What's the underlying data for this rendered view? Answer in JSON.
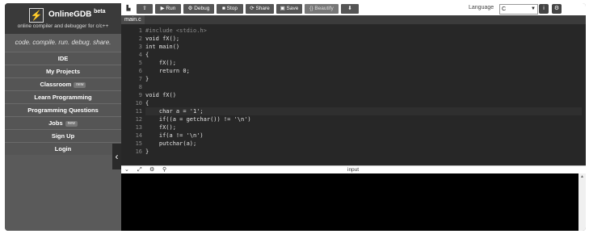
{
  "sidebar": {
    "logo_glyph": "⚡",
    "title": "OnlineGDB",
    "title_sup": "beta",
    "subtitle": "online compiler and debugger for c/c++",
    "tagline": "code. compile. run. debug. share.",
    "items": [
      {
        "label": "IDE",
        "badge": ""
      },
      {
        "label": "My Projects",
        "badge": ""
      },
      {
        "label": "Classroom",
        "badge": "new"
      },
      {
        "label": "Learn Programming",
        "badge": ""
      },
      {
        "label": "Programming Questions",
        "badge": ""
      },
      {
        "label": "Jobs",
        "badge": "new"
      },
      {
        "label": "Sign Up",
        "badge": ""
      },
      {
        "label": "Login",
        "badge": ""
      }
    ],
    "collapse_glyph": "‹"
  },
  "toolbar": {
    "new_icon": "▙",
    "upload_icon": "⇧",
    "run_label": "▶ Run",
    "debug_label": "⚙ Debug",
    "stop_label": "■ Stop",
    "share_label": "⟳ Share",
    "save_label": "▣ Save",
    "beautify_label": "{} Beautify",
    "download_icon": "⬇",
    "language_label": "Language",
    "language_value": "C",
    "info_icon": "i",
    "settings_icon": "⚙"
  },
  "tab": {
    "filename": "main.c"
  },
  "editor": {
    "line_numbers": [
      "1",
      "2",
      "3",
      "4",
      "5",
      "6",
      "7",
      "8",
      "9",
      "10",
      "11",
      "12",
      "13",
      "14",
      "15",
      "16"
    ],
    "lines": [
      "#include <stdio.h>",
      "void fX();",
      "int main()",
      "{",
      "    fX();",
      "    return 0;",
      "}",
      "",
      "void fX()",
      "{",
      "    char a = '1';",
      "    if((a = getchar()) != '\\n')",
      "    fX();",
      "    if(a != '\\n')",
      "    putchar(a);",
      "}"
    ]
  },
  "io": {
    "collapse_icon": "⌄",
    "expand_icon": "⤢",
    "settings_icon": "⚙",
    "debug_icon": "⚲",
    "label": "input"
  },
  "console": {
    "scroll_arrow": "▲"
  }
}
